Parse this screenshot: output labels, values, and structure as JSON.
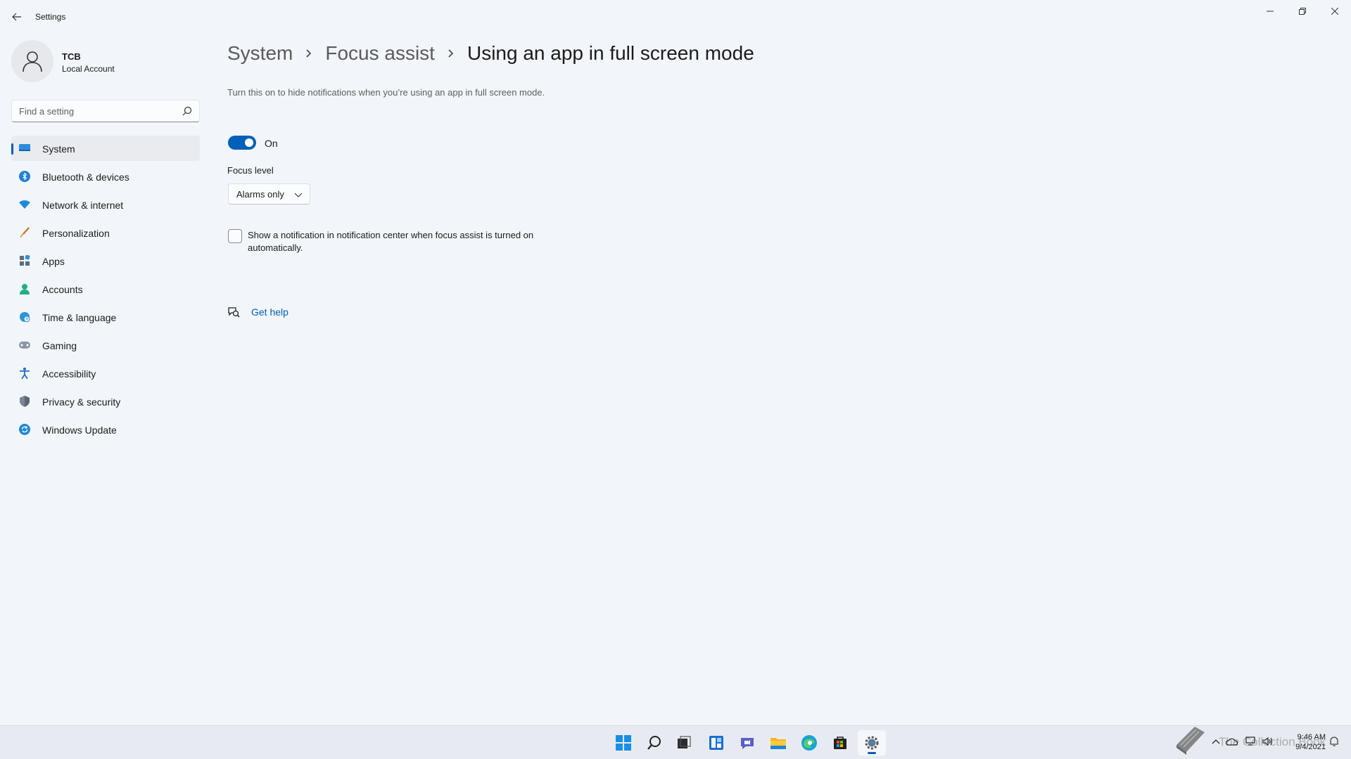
{
  "window": {
    "title": "Settings"
  },
  "profile": {
    "name": "TCB",
    "account_type": "Local Account"
  },
  "search": {
    "placeholder": "Find a setting"
  },
  "sidebar": {
    "items": [
      {
        "label": "System",
        "icon": "system-icon",
        "active": true
      },
      {
        "label": "Bluetooth & devices",
        "icon": "bluetooth-icon"
      },
      {
        "label": "Network & internet",
        "icon": "wifi-icon"
      },
      {
        "label": "Personalization",
        "icon": "brush-icon"
      },
      {
        "label": "Apps",
        "icon": "apps-icon"
      },
      {
        "label": "Accounts",
        "icon": "accounts-icon"
      },
      {
        "label": "Time & language",
        "icon": "globe-clock-icon"
      },
      {
        "label": "Gaming",
        "icon": "gamepad-icon"
      },
      {
        "label": "Accessibility",
        "icon": "accessibility-icon"
      },
      {
        "label": "Privacy & security",
        "icon": "shield-icon"
      },
      {
        "label": "Windows Update",
        "icon": "update-icon"
      }
    ]
  },
  "breadcrumb": {
    "level1": "System",
    "level2": "Focus assist",
    "current": "Using an app in full screen mode"
  },
  "content": {
    "description": "Turn this on to hide notifications when you’re using an app in full screen mode.",
    "toggle_state": "On",
    "focus_level_label": "Focus level",
    "focus_level_value": "Alarms only",
    "checkbox_label": "Show a notification in notification center when focus assist is turned on automatically.",
    "checkbox_checked": false,
    "help_link": "Get help"
  },
  "taskbar": {
    "apps": [
      "start-icon",
      "search-icon",
      "task-view-icon",
      "widgets-icon",
      "chat-icon",
      "file-explorer-icon",
      "edge-icon",
      "store-icon",
      "settings-icon"
    ],
    "active_app": "settings-icon"
  },
  "tray": {
    "time": "9:46 AM",
    "date": "9/4/2021",
    "watermark": "The Collection Book"
  },
  "colors": {
    "accent": "#005fb8",
    "background": "#f2f5fa"
  }
}
